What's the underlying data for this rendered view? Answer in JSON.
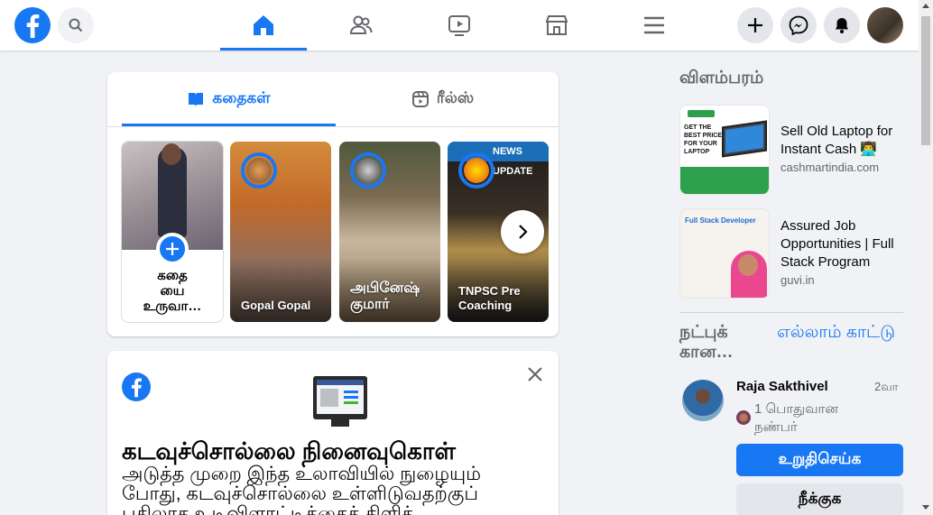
{
  "colors": {
    "accent": "#1877f2",
    "background": "#f0f2f5",
    "secondary_text": "#65676b"
  },
  "topbar": {
    "logo_icon": "facebook-logo-icon",
    "search_icon": "search-icon",
    "nav": [
      {
        "icon": "home-icon",
        "active": true
      },
      {
        "icon": "friends-icon",
        "active": false
      },
      {
        "icon": "watch-video-icon",
        "active": false
      },
      {
        "icon": "marketplace-icon",
        "active": false
      },
      {
        "icon": "menu-icon",
        "active": false
      }
    ],
    "right_buttons": [
      "plus-icon",
      "messenger-icon",
      "notifications-bell-icon"
    ]
  },
  "stories": {
    "tabs": [
      {
        "label": "கதைகள்",
        "icon": "book-icon",
        "active": true
      },
      {
        "label": "ரீல்ஸ்",
        "icon": "reels-icon",
        "active": false
      }
    ],
    "create_label": "கதை\nயை\nஉருவா…",
    "items": [
      {
        "name": "Gopal Gopal"
      },
      {
        "name": "அபினேஷ்\nகுமார்"
      },
      {
        "name": "TNPSC Pre\nCoaching",
        "banner": "NEWS UPDATE"
      }
    ]
  },
  "password_card": {
    "title": "கடவுச்சொல்லை நினைவுகொள்",
    "body": "அடுத்த முறை இந்த உலாவியில் நுழையும் போது, கடவுச்சொல்லை உள்ளிடுவதற்குப் பதிலாக உடிவிளாட்டிக்கைக் கிளிக்"
  },
  "sidebar": {
    "sponsored_title": "விளம்பரம்",
    "ads": [
      {
        "title": "Sell Old Laptop for Instant Cash 👨‍💻",
        "domain": "cashmartindia.com",
        "image_text": "GET THE BEST PRICE FOR YOUR LAPTOP"
      },
      {
        "title": "Assured Job Opportunities | Full Stack Program",
        "domain": "guvi.in",
        "image_text": "Full Stack Developer"
      }
    ],
    "friend_requests": {
      "title": "நட்புக் கான…",
      "see_all": "எல்லாம் காட்டு",
      "request": {
        "name": "Raja Sakthivel",
        "time": "2வா",
        "mutual": "1 பொதுவான நண்பர்",
        "confirm_label": "உறுதிசெய்க",
        "delete_label": "நீக்குக"
      }
    }
  }
}
